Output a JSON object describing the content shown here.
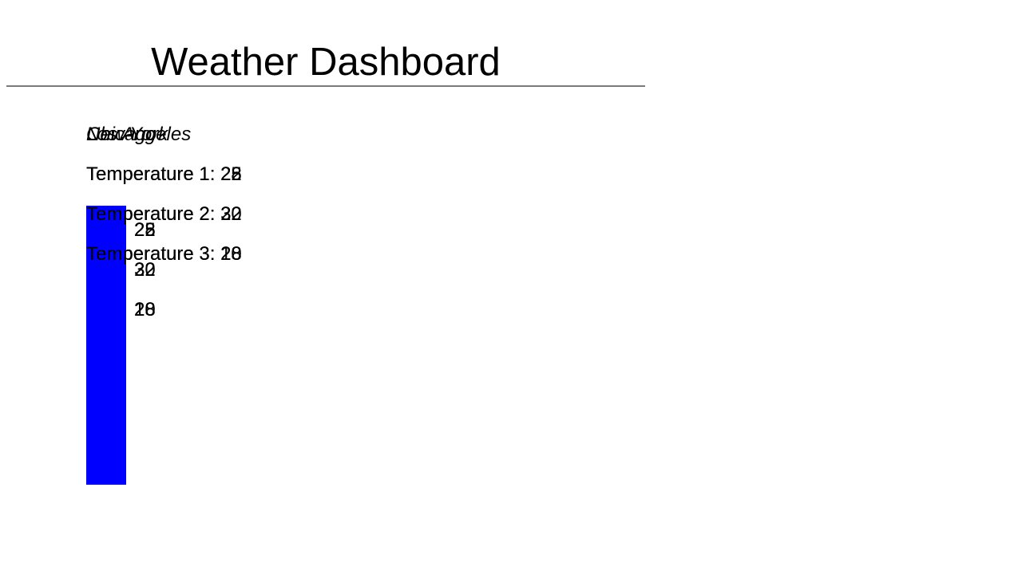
{
  "page": {
    "title": "Weather Dashboard"
  },
  "colors": {
    "bar": "#0000ff",
    "divider": "#7a7a7a",
    "text": "#000000"
  },
  "temperature_label": "Temperature",
  "cities": [
    {
      "name": "New York",
      "temperatures": [
        25,
        30,
        28
      ]
    },
    {
      "name": "Los Angeles",
      "temperatures": [
        22,
        32,
        20
      ]
    },
    {
      "name": "Chicago",
      "temperatures": [
        28,
        22,
        18
      ]
    }
  ]
}
